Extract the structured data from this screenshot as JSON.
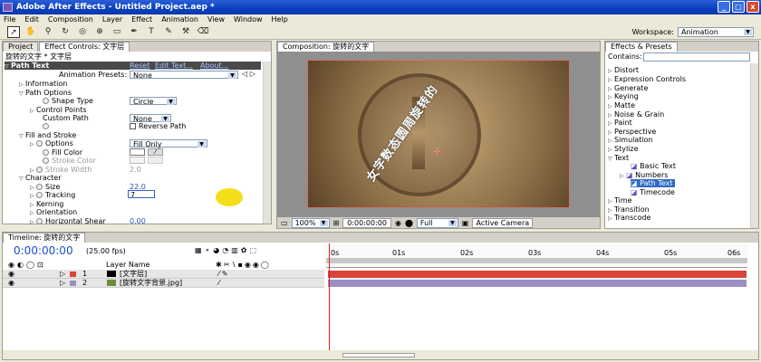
{
  "window": {
    "title": "Adobe After Effects - Untitled Project.aep *",
    "min": "_",
    "max": "□",
    "close": "x"
  },
  "menu": [
    "File",
    "Edit",
    "Composition",
    "Layer",
    "Effect",
    "Animation",
    "View",
    "Window",
    "Help"
  ],
  "workspace": {
    "label": "Workspace:",
    "value": "Animation"
  },
  "project_tab": "Project",
  "ec_tab": "Effect Controls: 文字层",
  "ec_path": "旋转的文字 * 文字层",
  "effect": {
    "name": "Path Text",
    "reset": "Reset",
    "edit": "Edit Text...",
    "about": "About...",
    "presets_label": "Animation Presets:",
    "presets_value": "None"
  },
  "props": {
    "information": "Information",
    "path_options": "Path Options",
    "shape_type": "Shape Type",
    "shape_type_val": "Circle",
    "control_points": "Control Points",
    "custom_path": "Custom Path",
    "custom_path_val": "None",
    "reverse_path": "Reverse Path",
    "fill_stroke": "Fill and Stroke",
    "options": "Options",
    "options_val": "Fill Only",
    "fill_color": "Fill Color",
    "stroke_color": "Stroke Color",
    "stroke_width": "Stroke Width",
    "stroke_width_val": "2.0",
    "character": "Character",
    "size": "Size",
    "size_val": "22.0",
    "tracking": "Tracking",
    "tracking_val": "7",
    "kerning": "Kerning",
    "orientation": "Orientation",
    "hshear": "Horizontal Shear",
    "hshear_val": "0.00"
  },
  "comp": {
    "tab": "Composition: 旋转的文字",
    "path_text": "女字数态圆周旋转的",
    "zoom": "100%",
    "time": "0:00:00:00",
    "res": "Full",
    "camera": "Active Camera"
  },
  "effects": {
    "tab": "Effects & Presets",
    "contains": "Contains:",
    "items": [
      "Distort",
      "Expression Controls",
      "Generate",
      "Keying",
      "Matte",
      "Noise & Grain",
      "Paint",
      "Perspective",
      "Simulation",
      "Stylize",
      "Text",
      "Basic Text",
      "Numbers",
      "Path Text",
      "Timecode",
      "Time",
      "Transition",
      "Transcode"
    ]
  },
  "timeline": {
    "tab": "Timeline: 旋转的文字",
    "time": "0:00:00:00",
    "fps": "(25.00 fps)",
    "layer_name_header": "Layer Name",
    "ticks": [
      "0s",
      "01s",
      "02s",
      "03s",
      "04s",
      "05s",
      "06s"
    ],
    "layers": [
      {
        "num": "1",
        "name": "[文字层]",
        "color": "#d8453a"
      },
      {
        "num": "2",
        "name": "[旋转文字背景.jpg]",
        "color": "#9b8fc2"
      }
    ]
  }
}
